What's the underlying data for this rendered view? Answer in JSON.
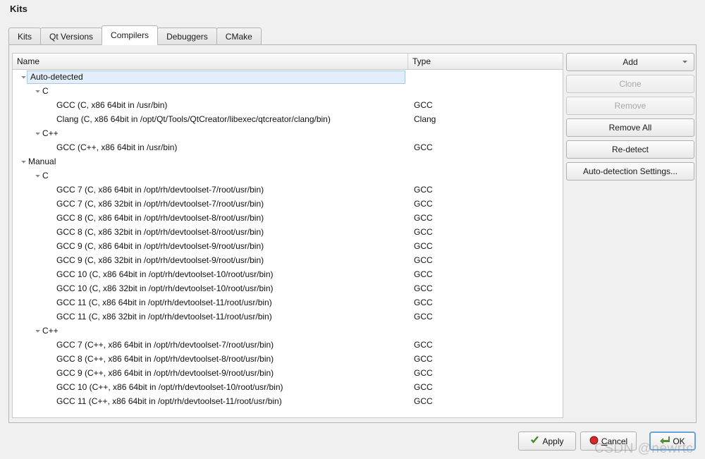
{
  "dialog": {
    "title": "Kits"
  },
  "tabs": [
    {
      "label": "Kits",
      "active": false
    },
    {
      "label": "Qt Versions",
      "active": false
    },
    {
      "label": "Compilers",
      "active": true
    },
    {
      "label": "Debuggers",
      "active": false
    },
    {
      "label": "CMake",
      "active": false
    }
  ],
  "tree": {
    "columns": {
      "name": "Name",
      "type": "Type"
    },
    "rows": [
      {
        "level": 0,
        "expander": "expanded",
        "name": "Auto-detected",
        "type": "",
        "selected": true
      },
      {
        "level": 1,
        "expander": "expanded",
        "name": "C",
        "type": "",
        "selected": false
      },
      {
        "level": 2,
        "expander": "none",
        "name": "GCC (C, x86 64bit in /usr/bin)",
        "type": "GCC",
        "selected": false
      },
      {
        "level": 2,
        "expander": "none",
        "name": "Clang (C, x86 64bit in /opt/Qt/Tools/QtCreator/libexec/qtcreator/clang/bin)",
        "type": "Clang",
        "selected": false
      },
      {
        "level": 1,
        "expander": "expanded",
        "name": "C++",
        "type": "",
        "selected": false
      },
      {
        "level": 2,
        "expander": "none",
        "name": "GCC (C++, x86 64bit in /usr/bin)",
        "type": "GCC",
        "selected": false
      },
      {
        "level": 0,
        "expander": "expanded",
        "name": "Manual",
        "type": "",
        "selected": false
      },
      {
        "level": 1,
        "expander": "expanded",
        "name": "C",
        "type": "",
        "selected": false
      },
      {
        "level": 2,
        "expander": "none",
        "name": "GCC 7 (C, x86 64bit in /opt/rh/devtoolset-7/root/usr/bin)",
        "type": "GCC",
        "selected": false
      },
      {
        "level": 2,
        "expander": "none",
        "name": "GCC 7 (C, x86 32bit in /opt/rh/devtoolset-7/root/usr/bin)",
        "type": "GCC",
        "selected": false
      },
      {
        "level": 2,
        "expander": "none",
        "name": "GCC 8 (C, x86 64bit in /opt/rh/devtoolset-8/root/usr/bin)",
        "type": "GCC",
        "selected": false
      },
      {
        "level": 2,
        "expander": "none",
        "name": "GCC 8 (C, x86 32bit in /opt/rh/devtoolset-8/root/usr/bin)",
        "type": "GCC",
        "selected": false
      },
      {
        "level": 2,
        "expander": "none",
        "name": "GCC 9 (C, x86 64bit in /opt/rh/devtoolset-9/root/usr/bin)",
        "type": "GCC",
        "selected": false
      },
      {
        "level": 2,
        "expander": "none",
        "name": "GCC 9 (C, x86 32bit in /opt/rh/devtoolset-9/root/usr/bin)",
        "type": "GCC",
        "selected": false
      },
      {
        "level": 2,
        "expander": "none",
        "name": "GCC 10 (C, x86 64bit in /opt/rh/devtoolset-10/root/usr/bin)",
        "type": "GCC",
        "selected": false
      },
      {
        "level": 2,
        "expander": "none",
        "name": "GCC 10 (C, x86 32bit in /opt/rh/devtoolset-10/root/usr/bin)",
        "type": "GCC",
        "selected": false
      },
      {
        "level": 2,
        "expander": "none",
        "name": "GCC 11 (C, x86 64bit in /opt/rh/devtoolset-11/root/usr/bin)",
        "type": "GCC",
        "selected": false
      },
      {
        "level": 2,
        "expander": "none",
        "name": "GCC 11 (C, x86 32bit in /opt/rh/devtoolset-11/root/usr/bin)",
        "type": "GCC",
        "selected": false
      },
      {
        "level": 1,
        "expander": "expanded",
        "name": "C++",
        "type": "",
        "selected": false
      },
      {
        "level": 2,
        "expander": "none",
        "name": "GCC 7 (C++, x86 64bit in /opt/rh/devtoolset-7/root/usr/bin)",
        "type": "GCC",
        "selected": false
      },
      {
        "level": 2,
        "expander": "none",
        "name": "GCC 8 (C++, x86 64bit in /opt/rh/devtoolset-8/root/usr/bin)",
        "type": "GCC",
        "selected": false
      },
      {
        "level": 2,
        "expander": "none",
        "name": "GCC 9 (C++, x86 64bit in /opt/rh/devtoolset-9/root/usr/bin)",
        "type": "GCC",
        "selected": false
      },
      {
        "level": 2,
        "expander": "none",
        "name": "GCC 10 (C++, x86 64bit in /opt/rh/devtoolset-10/root/usr/bin)",
        "type": "GCC",
        "selected": false
      },
      {
        "level": 2,
        "expander": "none",
        "name": "GCC 11 (C++, x86 64bit in /opt/rh/devtoolset-11/root/usr/bin)",
        "type": "GCC",
        "selected": false
      }
    ]
  },
  "side_buttons": [
    {
      "label": "Add",
      "enabled": true,
      "dropdown": true,
      "name": "add-button"
    },
    {
      "label": "Clone",
      "enabled": false,
      "dropdown": false,
      "name": "clone-button"
    },
    {
      "label": "Remove",
      "enabled": false,
      "dropdown": false,
      "name": "remove-button"
    },
    {
      "label": "Remove All",
      "enabled": true,
      "dropdown": false,
      "name": "remove-all-button"
    },
    {
      "label": "Re-detect",
      "enabled": true,
      "dropdown": false,
      "name": "re-detect-button"
    },
    {
      "label": "Auto-detection Settings...",
      "enabled": true,
      "dropdown": false,
      "name": "auto-detection-settings-button"
    }
  ],
  "bottom_buttons": {
    "apply": {
      "label": "Apply",
      "icon": "green-check-icon"
    },
    "cancel": {
      "mnemonic": "C",
      "rest": "ancel",
      "icon": "red-stop-icon"
    },
    "ok": {
      "label": "OK",
      "icon": "green-enter-arrow-icon",
      "default": true
    }
  },
  "watermark": {
    "text": "CSDN @newrtc"
  },
  "colors": {
    "selection_bg": "#e2eefa",
    "selection_border": "#a8c8e4",
    "accent_default_button": "#6ba3d6",
    "green": "#3f8f28",
    "red": "#cc2020",
    "panel_bg": "#f0f0f0"
  }
}
